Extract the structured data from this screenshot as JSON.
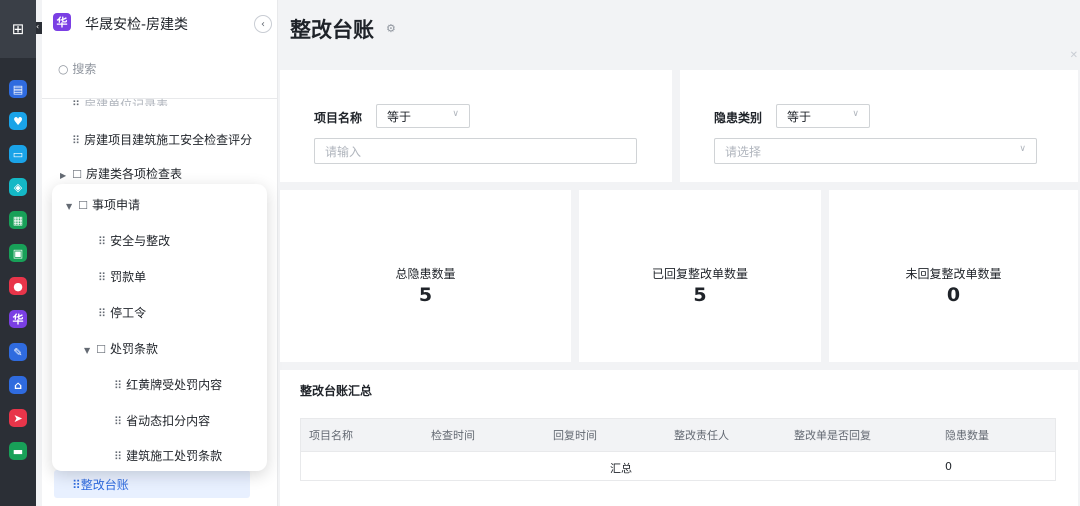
{
  "app": {
    "logo_char": "华",
    "name": "华晟安检-房建类"
  },
  "rail": {
    "top_icon": "grid-icon",
    "icons": [
      {
        "name": "rail-app-1-icon",
        "color": "#2f6bdf",
        "glyph": "▤"
      },
      {
        "name": "rail-app-2-icon",
        "color": "#1aa3e8",
        "glyph": "♥"
      },
      {
        "name": "rail-app-3-icon",
        "color": "#1aa3e8",
        "glyph": "▭"
      },
      {
        "name": "rail-app-4-icon",
        "color": "#14b8c6",
        "glyph": "◈"
      },
      {
        "name": "rail-app-5-icon",
        "color": "#18a058",
        "glyph": "▦"
      },
      {
        "name": "rail-app-6-icon",
        "color": "#18a058",
        "glyph": "▣"
      },
      {
        "name": "rail-app-7-icon",
        "color": "#e8354a",
        "glyph": "●"
      },
      {
        "name": "rail-app-8-icon",
        "color": "#7b3fe4",
        "glyph": "华"
      },
      {
        "name": "rail-app-9-icon",
        "color": "#2f6bdf",
        "glyph": "✎"
      },
      {
        "name": "rail-app-10-icon",
        "color": "#2f6bdf",
        "glyph": "⌂"
      },
      {
        "name": "rail-app-11-icon",
        "color": "#e8354a",
        "glyph": "➤"
      },
      {
        "name": "rail-app-12-icon",
        "color": "#18a058",
        "glyph": "▬"
      }
    ]
  },
  "sidebar": {
    "search_placeholder": "搜索",
    "faded_item": "房建单位记录表",
    "item_check_score": "房建项目建筑施工安全检查评分",
    "item_inspection": "房建类各项检查表",
    "active_item": "整改台账"
  },
  "popup": {
    "group_label": "事项申请",
    "items": [
      "安全与整改",
      "罚款单",
      "停工令"
    ],
    "sub_group_label": "处罚条款",
    "sub_items": [
      "红黄牌受处罚内容",
      "省动态扣分内容",
      "建筑施工处罚条款"
    ]
  },
  "page": {
    "title": "整改台账"
  },
  "filters": {
    "project_label": "项目名称",
    "project_op": "等于",
    "project_placeholder": "请输入",
    "hazard_label": "隐患类别",
    "hazard_op": "等于",
    "hazard_placeholder": "请选择"
  },
  "stats": [
    {
      "label": "总隐患数量",
      "value": "5"
    },
    {
      "label": "已回复整改单数量",
      "value": "5"
    },
    {
      "label": "未回复整改单数量",
      "value": "0"
    }
  ],
  "summary": {
    "title": "整改台账汇总",
    "columns": [
      "项目名称",
      "检查时间",
      "回复时间",
      "整改责任人",
      "整改单是否回复",
      "隐患数量"
    ],
    "total_label": "汇总",
    "total_value": "0"
  }
}
